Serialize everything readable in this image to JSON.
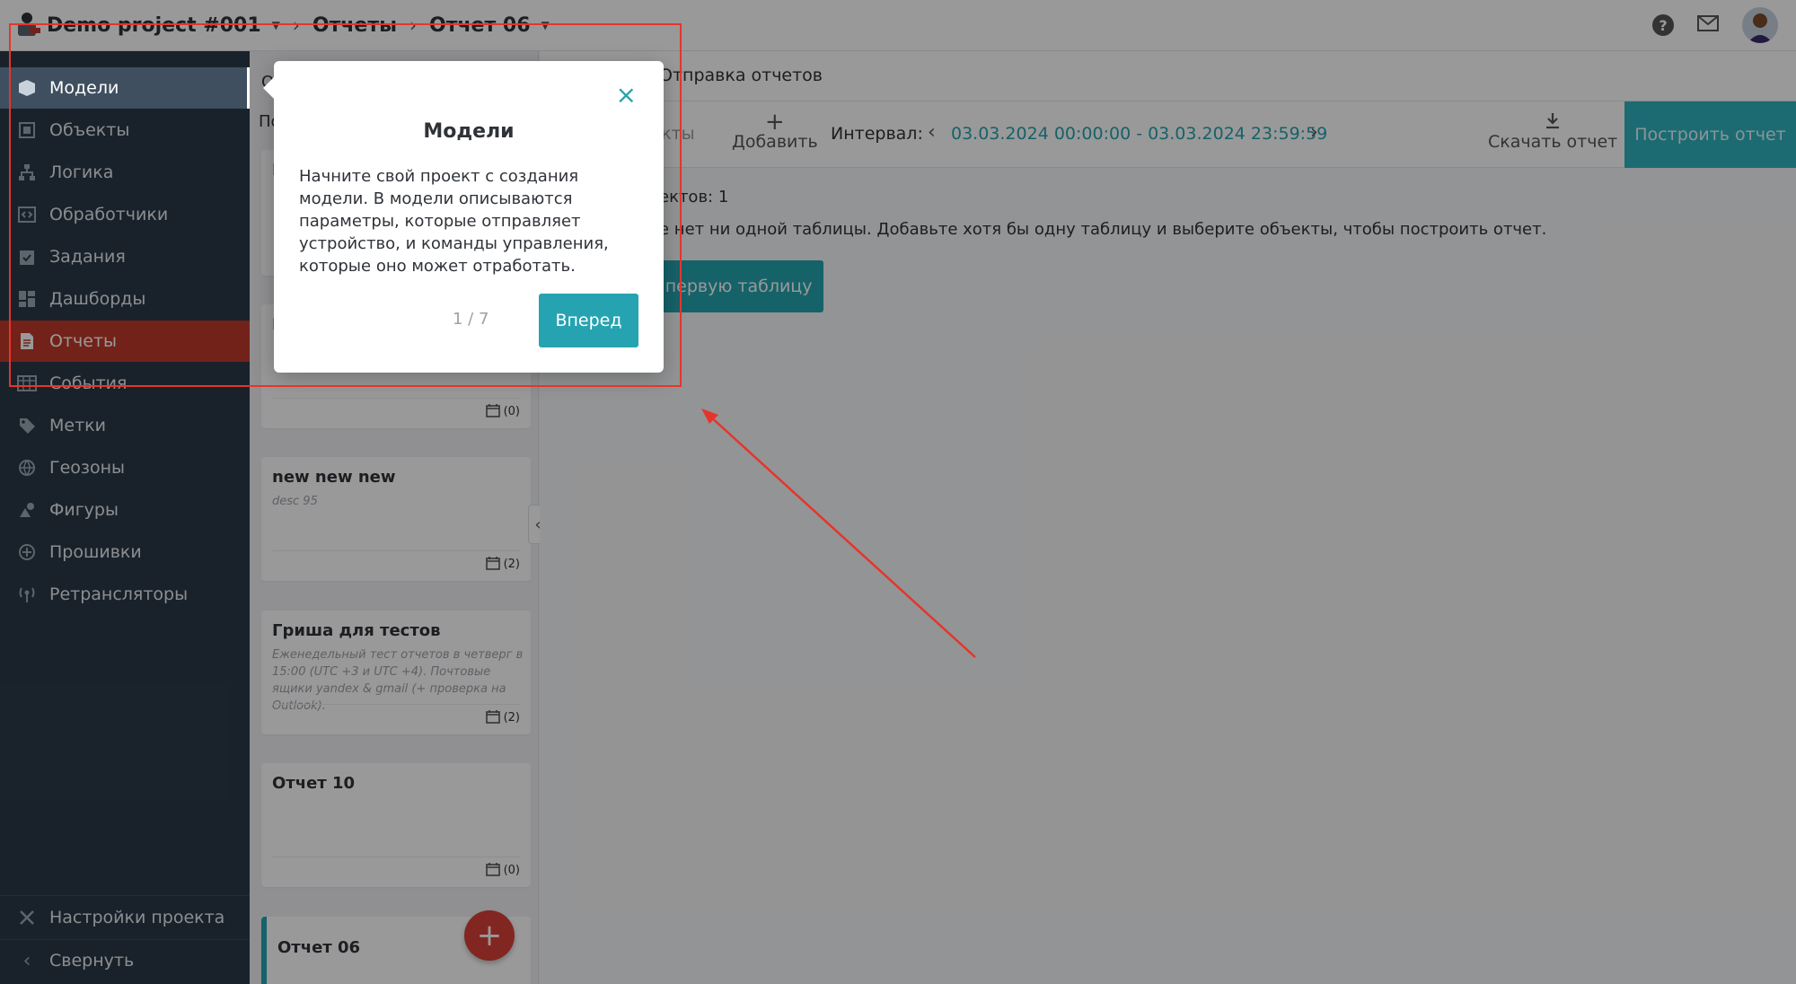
{
  "header": {
    "project": "Demo project #001",
    "section": "Отчеты",
    "report": "Отчет 06"
  },
  "sidebar": {
    "items": [
      {
        "label": "Модели",
        "icon": "cube-icon"
      },
      {
        "label": "Объекты",
        "icon": "square-icon"
      },
      {
        "label": "Логика",
        "icon": "hierarchy-icon"
      },
      {
        "label": "Обработчики",
        "icon": "code-icon"
      },
      {
        "label": "Задания",
        "icon": "clipboard-icon"
      },
      {
        "label": "Дашборды",
        "icon": "dashboard-icon"
      },
      {
        "label": "Отчеты",
        "icon": "document-icon"
      },
      {
        "label": "События",
        "icon": "table-icon"
      },
      {
        "label": "Метки",
        "icon": "tag-icon"
      },
      {
        "label": "Геозоны",
        "icon": "globe-icon"
      },
      {
        "label": "Фигуры",
        "icon": "shapes-icon"
      },
      {
        "label": "Прошивки",
        "icon": "firmware-icon"
      },
      {
        "label": "Ретрансляторы",
        "icon": "antenna-icon"
      }
    ],
    "settings_label": "Настройки проекта",
    "collapse_label": "Свернуть"
  },
  "reports_list": {
    "partial_labels": [
      "О",
      "По",
      "Н",
      "Н"
    ],
    "cards": [
      {
        "title": "",
        "desc": "",
        "count": "(0)"
      },
      {
        "title": "new new new",
        "desc": "desc 95",
        "count": "(2)"
      },
      {
        "title": "Гриша для тестов",
        "desc": "Еженедельный тест отчетов в четверг в 15:00 (UTC +3 и UTC +4). Почтовые ящики yandex & gmail (+ проверка на Outlook).",
        "count": "(2)"
      },
      {
        "title": "Отчет 10",
        "desc": "",
        "count": "(0)"
      },
      {
        "title": "Отчет 06",
        "desc": "",
        "count": ""
      }
    ]
  },
  "main": {
    "title": "Отправка отчетов",
    "toolbar": {
      "objects_label": "ъекты",
      "add_label": "Добавить",
      "interval_label": "Интервал:",
      "interval_value": "03.03.2024 00:00:00 - 03.03.2024 23:59:59",
      "download_label": "Скачать отчет",
      "build_label": "Построить отчет"
    },
    "objects_count": "ектов: 1",
    "empty_message": "е нет ни одной таблицы. Добавьте хотя бы одну таблицу и выберите объекты, чтобы построить отчет.",
    "add_table_label": "ь первую таблицу"
  },
  "popover": {
    "title": "Модели",
    "body": "Начните свой проект с создания модели. В модели описываются параметры, которые отправляет устройство,  и команды управления, которые оно может отработать.",
    "step": "1 / 7",
    "next_label": "Вперед"
  },
  "colors": {
    "accent": "#26a3b0",
    "sidebar_bg": "#2b3947",
    "active_red": "#c0392b",
    "annotation": "#e5352b"
  }
}
